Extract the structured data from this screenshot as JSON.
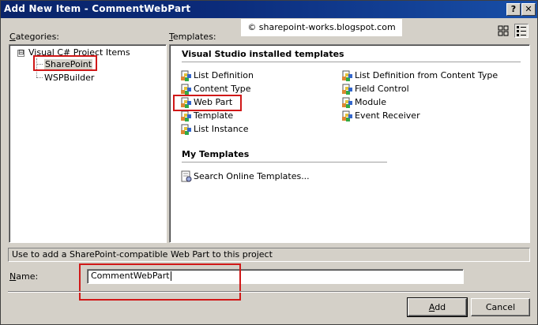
{
  "window": {
    "title": "Add New Item - CommentWebPart",
    "help_label": "?",
    "close_label": "✕"
  },
  "watermark": "© sharepoint-works.blogspot.com",
  "categories": {
    "label": "Categories:",
    "root": {
      "expander": "⊟",
      "label": "Visual C# Project Items"
    },
    "children": [
      {
        "label": "SharePoint",
        "selected": true
      },
      {
        "label": "WSPBuilder",
        "selected": false
      }
    ]
  },
  "templates": {
    "label": "Templates:",
    "installed_heading": "Visual Studio installed templates",
    "installed": [
      {
        "label": "List Definition",
        "icon": "template-icon",
        "column": 0,
        "row": 0
      },
      {
        "label": "Content Type",
        "icon": "template-icon",
        "column": 0,
        "row": 1
      },
      {
        "label": "Web Part",
        "icon": "template-icon",
        "column": 0,
        "row": 2,
        "selected": true
      },
      {
        "label": "Template",
        "icon": "template-icon",
        "column": 0,
        "row": 3
      },
      {
        "label": "List Instance",
        "icon": "template-icon",
        "column": 0,
        "row": 4
      },
      {
        "label": "List Definition from Content Type",
        "icon": "template-icon",
        "column": 1,
        "row": 0
      },
      {
        "label": "Field Control",
        "icon": "template-icon",
        "column": 1,
        "row": 1
      },
      {
        "label": "Module",
        "icon": "template-icon",
        "column": 1,
        "row": 2
      },
      {
        "label": "Event Receiver",
        "icon": "template-icon",
        "column": 1,
        "row": 3
      }
    ],
    "my_heading": "My Templates",
    "my": [
      {
        "label": "Search Online Templates...",
        "icon": "search-online-icon"
      }
    ]
  },
  "status": "Use to add a SharePoint-compatible Web Part to this project",
  "name": {
    "label": "Name:",
    "value": "CommentWebPart"
  },
  "buttons": {
    "add": "Add",
    "cancel": "Cancel"
  },
  "colors": {
    "titlebar": "#0a246a",
    "dialog_bg": "#d4d0c8",
    "highlight_box": "#d01818"
  }
}
